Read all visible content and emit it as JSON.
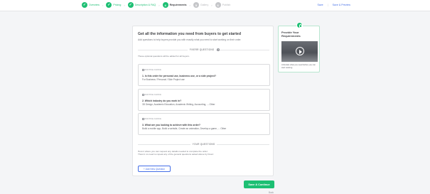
{
  "steps": [
    {
      "num": "✓",
      "label": "Overview",
      "state": "done"
    },
    {
      "num": "✓",
      "label": "Pricing",
      "state": "done"
    },
    {
      "num": "✓",
      "label": "Description & FAQ",
      "state": "done"
    },
    {
      "num": "4",
      "label": "Requirements",
      "state": "current"
    },
    {
      "num": "5",
      "label": "Gallery",
      "state": "todo"
    },
    {
      "num": "6",
      "label": "Publish",
      "state": "todo"
    }
  ],
  "step_separator": "›",
  "top_actions": {
    "save": "Save",
    "divider": "|",
    "save_preview": "Save & Preview"
  },
  "main": {
    "title": "Get all the information you need from buyers to get started",
    "subtitle": "Add questions to help buyers provide you with exactly what you need to start working on their order.",
    "fiverr_section": "FIVERR QUESTIONS",
    "help_glyph": "?",
    "fiverr_note": "These optional questions will be added for all buyers.",
    "questions": [
      {
        "tag": "MULTIPLE CHOICE",
        "question": "1. Is this order for personal use, business use, or a side project?",
        "answer": "For Business / Personal / Side Project use"
      },
      {
        "tag": "MULTIPLE CHOICE",
        "question": "2. Which industry do you work in?",
        "answer": "3D Design, Academic Education, Academic Writing, Accounting, ... Other"
      },
      {
        "tag": "MULTIPLE CHOICE",
        "question": "3. What are you looking to achieve with this order?",
        "answer": "Build a mobile app, Build a website, Create an animation, Develop a game, ... Other"
      }
    ],
    "your_section": "YOUR QUESTIONS",
    "your_note_1": "Here's where you can request any details needed to complete the order.",
    "your_note_2": "There's no need to repeat any of the general questions asked above by Fiverr.",
    "add_button": "+ Add New Question"
  },
  "tip": {
    "title": "Provide Your Requirements",
    "text": "Articulate what you need before you can start working."
  },
  "save_continue": "Save & Continue",
  "back": "Back"
}
